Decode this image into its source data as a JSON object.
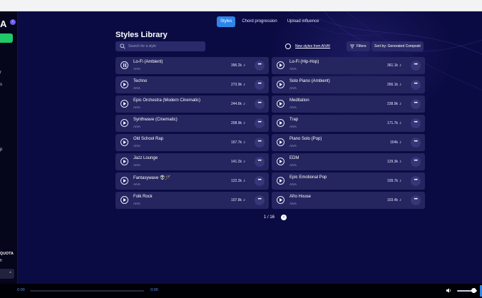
{
  "app": {
    "logo_letter": "A",
    "sidebar_marks": [
      "r",
      "s",
      "p"
    ],
    "quota_label": "QUOTA",
    "quota_sub": "ft",
    "quota_button": "^"
  },
  "tabs": [
    {
      "label": "Styles",
      "active": true
    },
    {
      "label": "Chord progression",
      "active": false
    },
    {
      "label": "Upload influence",
      "active": false
    }
  ],
  "library": {
    "title": "Styles Library",
    "search_placeholder": "Search for a style",
    "new_styles_label": "New styles from AIVA!",
    "filters_label": "Filters",
    "sort_label": "Sort by: Generated Composit"
  },
  "styles": [
    {
      "name": "Lo-Fi (Ambient)",
      "author": "AIVA",
      "plays": "396.2k",
      "icon": "pause-icon"
    },
    {
      "name": "Lo-Fi (Hip-Hop)",
      "author": "AIVA",
      "plays": "361.1k",
      "icon": "play-icon"
    },
    {
      "name": "Techno",
      "author": "AIVA",
      "plays": "273.9k",
      "icon": "play-icon"
    },
    {
      "name": "Solo Piano (Ambient)",
      "author": "AIVA",
      "plays": "266.1k",
      "icon": "play-icon"
    },
    {
      "name": "Epic Orchestra (Modern Cinematic)",
      "author": "AIVA",
      "plays": "244.6k",
      "icon": "play-icon"
    },
    {
      "name": "Meditation",
      "author": "AIVA",
      "plays": "238.9k",
      "icon": "play-icon"
    },
    {
      "name": "Synthwave (Cinematic)",
      "author": "AIVA",
      "plays": "208.9k",
      "icon": "play-icon"
    },
    {
      "name": "Trap",
      "author": "AIVA",
      "plays": "171.7k",
      "icon": "play-icon"
    },
    {
      "name": "Old School Rap",
      "author": "AIVA",
      "plays": "167.7k",
      "icon": "play-icon"
    },
    {
      "name": "Piano Solo (Pop)",
      "author": "AIVA",
      "plays": "164k",
      "icon": "play-icon"
    },
    {
      "name": "Jazz Lounge",
      "author": "AIVA",
      "plays": "141.2k",
      "icon": "play-icon"
    },
    {
      "name": "EDM",
      "author": "AIVA",
      "plays": "129.3k",
      "icon": "play-icon"
    },
    {
      "name": "Fantasywave 👽🪄",
      "author": "AIVA",
      "plays": "122.2k",
      "icon": "play-icon"
    },
    {
      "name": "Epic Emotional Pop",
      "author": "AIVA",
      "plays": "109.7k",
      "icon": "play-icon"
    },
    {
      "name": "Folk Rock",
      "author": "AIVA",
      "plays": "107.8k",
      "icon": "play-icon"
    },
    {
      "name": "Afro House",
      "author": "AIVA",
      "plays": "103.4k",
      "icon": "play-icon"
    }
  ],
  "more_label": "•••",
  "note_glyph": "♪",
  "pagination": {
    "text": "1 / 16",
    "next_label": "›"
  },
  "player": {
    "time_current": "0:00",
    "time_total": "0:00",
    "volume_fraction": 0.85
  },
  "colors": {
    "background": "#0b0b44",
    "card": "#252560",
    "accent_tab": "#2f86e8",
    "new_button": "#20c967",
    "sidebar": "#05051c"
  }
}
